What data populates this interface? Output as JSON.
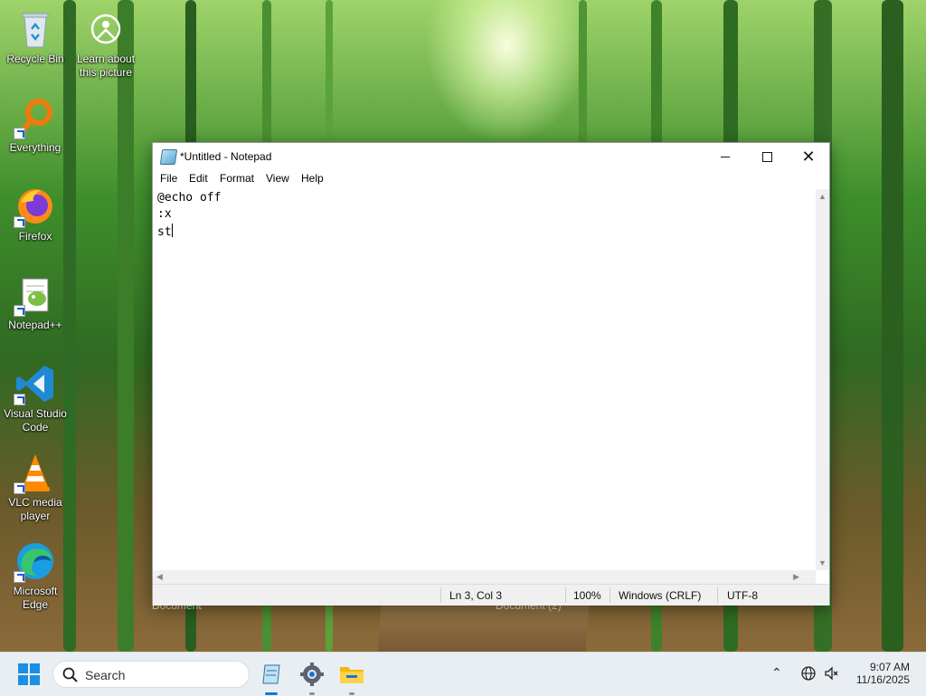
{
  "desktop": {
    "icons": [
      {
        "label": "Recycle Bin",
        "icon": "recycle-bin-icon"
      },
      {
        "label": "Learn about this picture",
        "icon": "learn-picture-icon"
      },
      {
        "label": "Everything",
        "icon": "everything-search-icon"
      },
      {
        "label": "Firefox",
        "icon": "firefox-icon"
      },
      {
        "label": "Notepad++",
        "icon": "notepad-plus-plus-icon"
      },
      {
        "label": "Visual Studio Code",
        "icon": "vscode-icon"
      },
      {
        "label": "VLC media player",
        "icon": "vlc-icon"
      },
      {
        "label": "Microsoft Edge",
        "icon": "edge-icon"
      }
    ],
    "background_labels": [
      "Document",
      "Document (2)"
    ]
  },
  "notepad": {
    "title": "*Untitled - Notepad",
    "menu": [
      "File",
      "Edit",
      "Format",
      "View",
      "Help"
    ],
    "lines": [
      "@echo off",
      ":x",
      "st"
    ],
    "status": {
      "position": "Ln 3, Col 3",
      "zoom": "100%",
      "line_ending": "Windows (CRLF)",
      "encoding": "UTF-8"
    }
  },
  "taskbar": {
    "search_label": "Search",
    "pinned": [
      "notepad-icon",
      "settings-gear-icon",
      "file-explorer-icon"
    ],
    "clock": {
      "time": "9:07 AM",
      "date": "11/16/2025"
    }
  }
}
